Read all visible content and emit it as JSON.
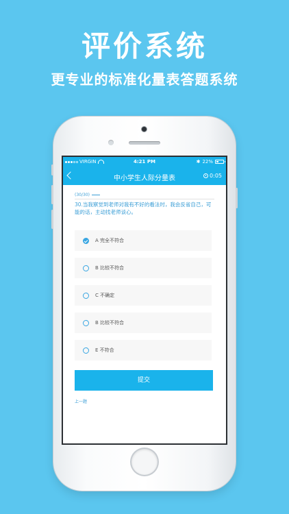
{
  "hero": {
    "title": "评价系统",
    "subtitle": "更专业的标准化量表答题系统"
  },
  "status_bar": {
    "carrier": "VIRGIN",
    "time": "4:21 PM",
    "battery": "22%",
    "bluetooth_symbol": "✱"
  },
  "nav": {
    "title": "中小学生人际分量表",
    "timer": "0:05",
    "back_icon": "chevron-left-icon",
    "timer_icon": "clock-icon"
  },
  "quiz": {
    "progress": "(30/30)",
    "question": "30.当我察觉到老师对我有不好的看法时，我会反省自己，可能的话，主动找老师谈心。",
    "options": [
      {
        "label": "A 完全不符合",
        "selected": true
      },
      {
        "label": "B 比较不符合",
        "selected": false
      },
      {
        "label": "C 不确定",
        "selected": false
      },
      {
        "label": "B 比较不符合",
        "selected": false
      },
      {
        "label": "E 不符合",
        "selected": false
      }
    ],
    "submit_label": "提交",
    "prev_label": "上一题"
  },
  "colors": {
    "background": "#5bc6ef",
    "primary": "#1ab3eb",
    "accent_text": "#3b9ed6"
  }
}
